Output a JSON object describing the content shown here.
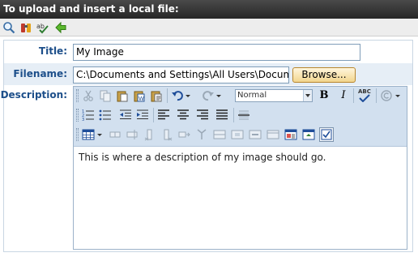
{
  "titlebar": {
    "text": "To upload and insert a local file:"
  },
  "top_toolbar": {
    "icons": [
      "search-icon",
      "binoculars-icon",
      "spellcheck-icon",
      "back-arrow-icon"
    ]
  },
  "form": {
    "title_label": "Title:",
    "title_value": "My Image",
    "filename_label": "Filename:",
    "filename_value": "C:\\Documents and Settings\\All Users\\Documents\\",
    "browse_label": "Browse...",
    "description_label": "Description:"
  },
  "editor": {
    "format_value": "Normal",
    "bold_label": "B",
    "italic_label": "I",
    "spell_label": "ABC",
    "content": "This is where a description of my image should go."
  },
  "colors": {
    "titlebar_bg": "#262626",
    "label_blue": "#1d4f8a",
    "toolbar_bg": "#d2e0ef",
    "browse_bg": "#f2d58e"
  }
}
